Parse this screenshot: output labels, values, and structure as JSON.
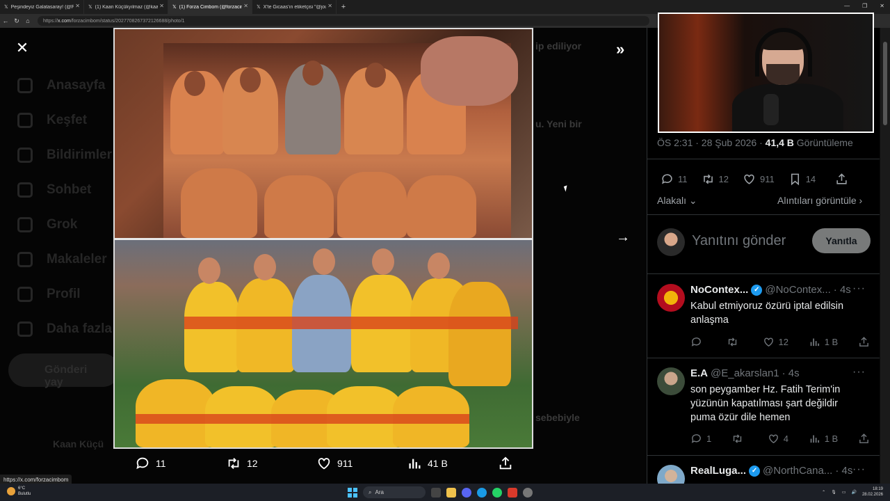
{
  "browser": {
    "tabs": [
      {
        "label": "Peşindeyiz Galatasaray! (@Pesinde",
        "favicon": "x-icon",
        "active": false
      },
      {
        "label": "(1) Kaan Küçükyılmaz (@kaankck",
        "favicon": "x-icon",
        "active": false
      },
      {
        "label": "(1) Forza Cimbom (@forzacimbom",
        "favicon": "x-icon",
        "active": true
      },
      {
        "label": "X'te Gicaas'ın etiketçisi \"@jouskur",
        "favicon": "x-icon",
        "active": false
      }
    ],
    "url_prefix": "https://",
    "url_domain": "x.com",
    "url_path": "/forzacimbom/status/2027708267372126688/photo/1",
    "status_url": "https://x.com/forzacimbom"
  },
  "background_nav": [
    "Anasayfa",
    "Keşfet",
    "Bildirimler",
    "Sohbet",
    "Grok",
    "Makaleler",
    "Profil",
    "Daha fazla"
  ],
  "background_post_button": "Gönderi yay",
  "background_user": "Kaan Küçü",
  "background_snippets": [
    "ip ediliyor",
    "u. Yeni bir",
    "sebebiyle"
  ],
  "media_viewer": {
    "actions": {
      "replies": "11",
      "reposts": "12",
      "likes": "911",
      "views": "41 B"
    }
  },
  "post_meta": {
    "time": "ÖS 2:31 · 28 Şub 2026 · ",
    "views_count": "41,4 B",
    "views_label": " Görüntüleme"
  },
  "post_stats": {
    "replies": "11",
    "reposts": "12",
    "likes": "911",
    "bookmarks": "14"
  },
  "sort": {
    "relevant": "Alakalı",
    "quotes": "Alıntıları görüntüle"
  },
  "reply_box": {
    "placeholder": "Yanıtını gönder",
    "button": "Yanıtla"
  },
  "replies": [
    {
      "name": "NoContex...",
      "handle": "@NoContex...",
      "age": "· 4s",
      "verified": true,
      "text": "Kabul etmiyoruz özürü iptal edilsin anlaşma",
      "replies": "",
      "reposts": "",
      "likes": "12",
      "views": "1 B",
      "avatar_color": "#c8102e"
    },
    {
      "name": "E.A",
      "handle": "@E_akarslan1",
      "age": "· 4s",
      "verified": false,
      "text": "son peygamber Hz. Fatih Terim'in yüzünün kapatılması şart değildir puma özür dile hemen",
      "replies": "1",
      "reposts": "",
      "likes": "4",
      "views": "1 B",
      "avatar_color": "#6a5a4a"
    },
    {
      "name": "RealLuga...",
      "handle": "@NorthCana...",
      "age": "· 4s",
      "verified": true,
      "text": "",
      "replies": "",
      "reposts": "",
      "likes": "",
      "views": "",
      "avatar_color": "#7fa9c9"
    }
  ],
  "taskbar": {
    "weather_temp": "6°C",
    "weather_desc": "Bulutlu",
    "search": "Ara",
    "time": "18:19",
    "date": "28.02.2026"
  },
  "colors": {
    "accent": "#1d9bf0",
    "background": "#000000",
    "reply_button": "#787a7a"
  }
}
